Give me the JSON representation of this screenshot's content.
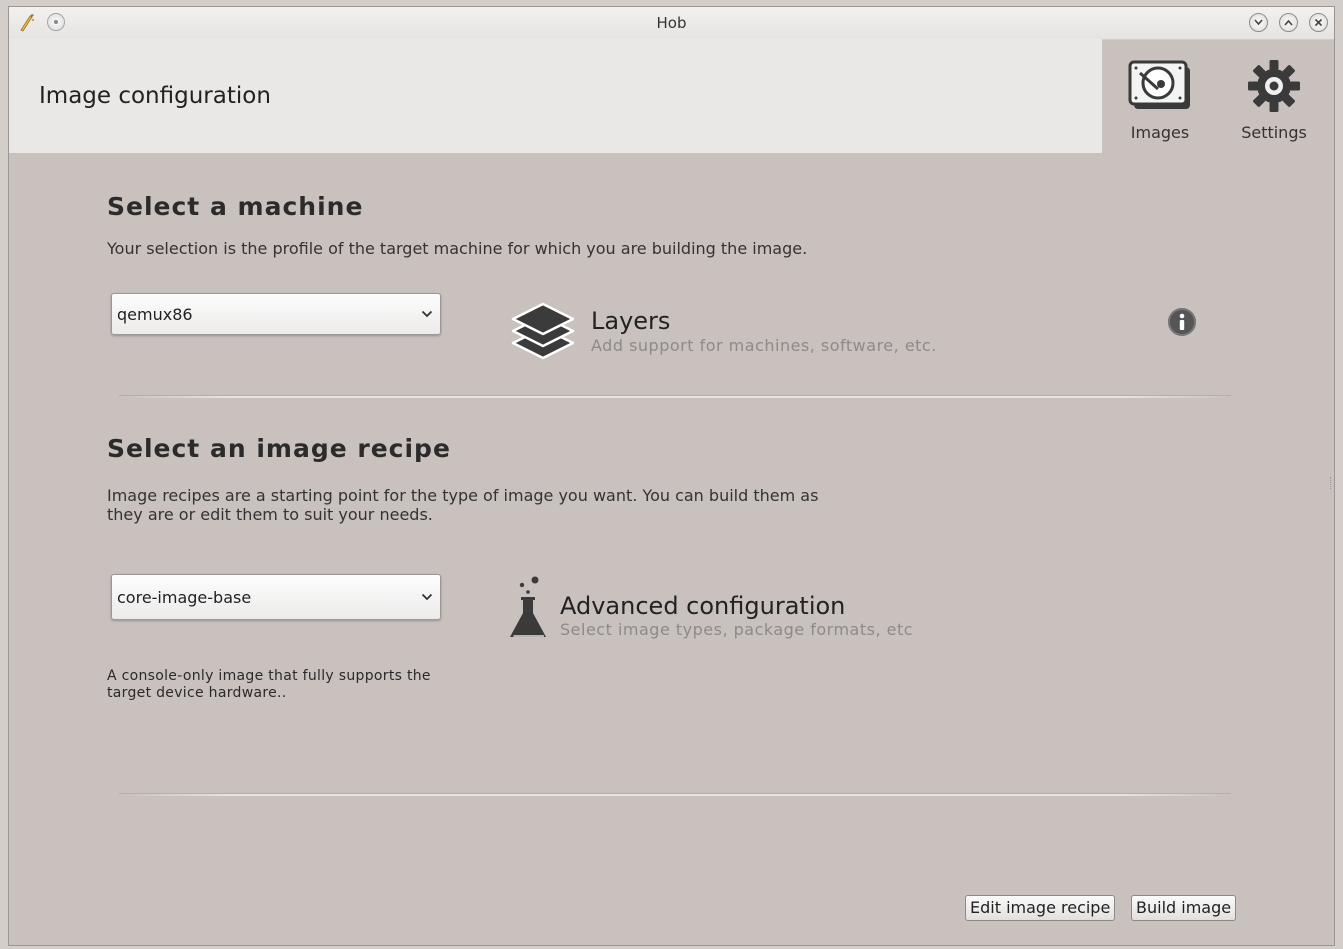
{
  "window": {
    "title": "Hob"
  },
  "header": {
    "title": "Image configuration",
    "images_label": "Images",
    "settings_label": "Settings"
  },
  "machine": {
    "heading": "Select a machine",
    "description": "Your selection is the profile of the target machine for which you are building the image.",
    "selected": "qemux86"
  },
  "layers": {
    "title": "Layers",
    "subtitle": "Add support for machines, software, etc."
  },
  "recipe": {
    "heading": "Select an image recipe",
    "description_line1": "Image recipes are a starting point for the type of image you want. You can build them as",
    "description_line2": "they are or edit them to suit your needs.",
    "selected": "core-image-base",
    "note_line1": "A console-only image that fully supports the",
    "note_line2": "target device hardware.."
  },
  "advanced": {
    "title": "Advanced configuration",
    "subtitle": "Select image types, package formats, etc"
  },
  "buttons": {
    "edit_recipe": "Edit image recipe",
    "build_image": "Build image"
  }
}
